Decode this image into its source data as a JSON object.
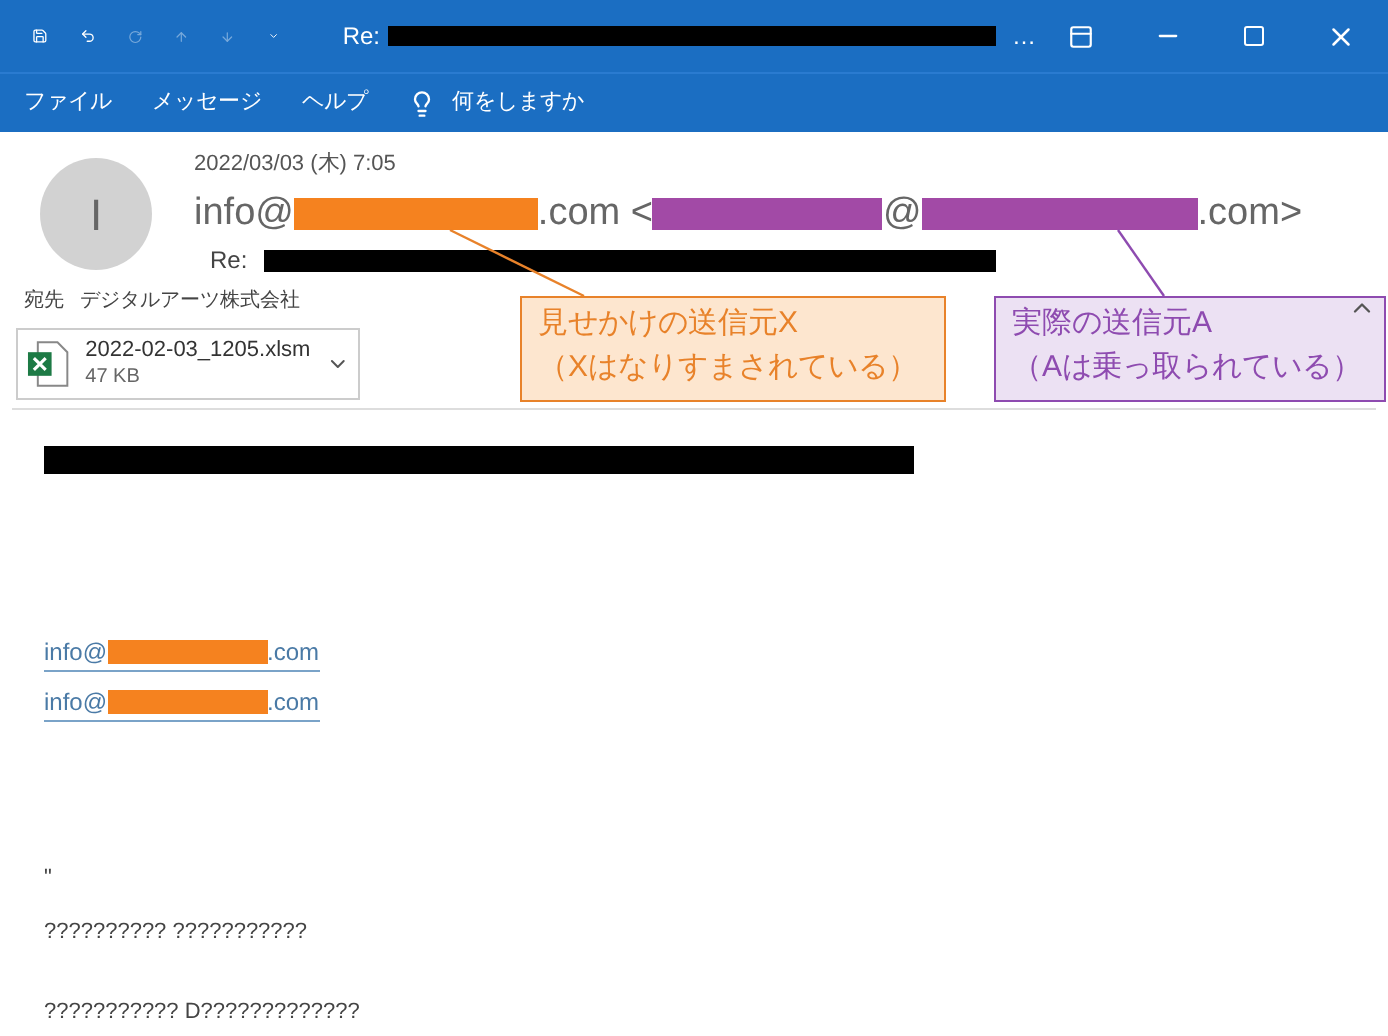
{
  "window": {
    "title_prefix": "Re:",
    "title_redaction": {
      "color": "#000000"
    },
    "title_ellipsis": "…"
  },
  "menu": [
    {
      "label": "ファイル"
    },
    {
      "label": "メッセージ"
    },
    {
      "label": "ヘルプ"
    }
  ],
  "tell_me": {
    "placeholder": "何をしますか"
  },
  "header": {
    "avatar_initial": "I",
    "date": "2022/03/03 (木) 7:05",
    "sender": [
      {
        "kind": "text",
        "text": "info@"
      },
      {
        "kind": "redaction",
        "color": "#f5821f"
      },
      {
        "kind": "text",
        "text": ".com <"
      },
      {
        "kind": "redaction",
        "color": "#a24aa6"
      },
      {
        "kind": "text",
        "text": "@"
      },
      {
        "kind": "redaction",
        "color": "#a24aa6"
      },
      {
        "kind": "text",
        "text": ".com>"
      }
    ],
    "subject_prefix": "Re:",
    "subject_redaction": {
      "color": "#000000"
    },
    "to_label": "宛先",
    "to": "デジタルアーツ株式会社"
  },
  "attachment": {
    "name": "2022-02-03_1205.xlsm",
    "size": "47 KB"
  },
  "callouts": [
    {
      "line1": "見せかけの送信元X",
      "line2": "（Xはなりすまされている）",
      "color": "#e8822a"
    },
    {
      "line1": "実際の送信元A",
      "line2": "（Aは乗っ取られている）",
      "color": "#8e4bb0"
    }
  ],
  "body": {
    "top_redaction": {
      "color": "#000000"
    },
    "links": [
      {
        "prefix": "info@",
        "suffix": ".com",
        "redaction": {
          "color": "#f5821f"
        }
      },
      {
        "prefix": "info@",
        "suffix": ".com",
        "redaction": {
          "color": "#f5821f"
        }
      }
    ],
    "lines": [
      "\"",
      "?????????? ???????????",
      "??????????? D?????????????"
    ]
  }
}
